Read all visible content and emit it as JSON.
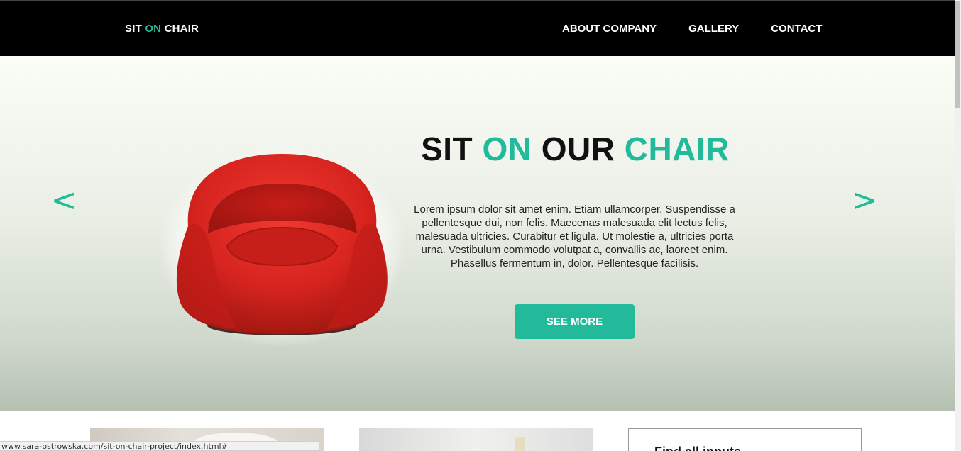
{
  "nav": {
    "logo": {
      "part1": "SIT ",
      "part2": "ON",
      "part3": " CHAIR"
    },
    "links": [
      "ABOUT COMPANY",
      "GALLERY",
      "CONTACT"
    ]
  },
  "hero": {
    "title": {
      "w1": "SIT ",
      "w2": "ON",
      "w3": " OUR ",
      "w4": "CHAIR"
    },
    "text": "Lorem ipsum dolor sit amet enim. Etiam ullamcorper. Suspendisse a pellentesque dui, non felis. Maecenas malesuada elit lectus felis, malesuada ultricies. Curabitur et ligula. Ut molestie a, ultricies porta urna. Vestibulum commodo volutpat a, convallis ac, laoreet enim. Phasellus fermentum in, dolor. Pellentesque facilisis.",
    "button": "SEE MORE",
    "prev_arrow": "<",
    "next_arrow": ">"
  },
  "cards": {
    "box_title": "Find all inputs"
  },
  "status_bar": {
    "url": "www.sara-ostrowska.com/sit-on-chair-project/index.html#"
  },
  "colors": {
    "accent": "#23b99b",
    "nav_bg": "#000000",
    "chair": "#d8241f"
  },
  "icons": {
    "prev": "chevron-left-icon",
    "next": "chevron-right-icon"
  }
}
